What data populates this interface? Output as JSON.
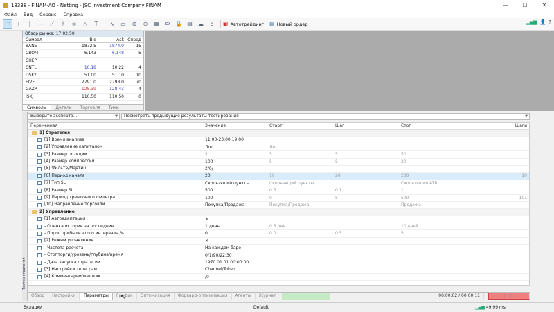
{
  "title": "18338 - FINAM-AO - Netting - JSC Investment Company FINAM",
  "menu": [
    "Файл",
    "Вид",
    "Сервис",
    "Справка"
  ],
  "window_controls": {
    "minimize": "—",
    "maximize": "☐",
    "close": "✕"
  },
  "toolbar": {
    "idx_label": "IDX",
    "autotrade_label": "Автотрейдинг",
    "new_order_label": "Новый ордер"
  },
  "market_watch": {
    "header": "Обзор рынка: 17:02:50",
    "columns": {
      "symbol": "Символ",
      "bid": "Bid",
      "ask": "Ask",
      "spread": "Спред"
    },
    "rows": [
      {
        "symbol": "BANE",
        "bid": "1872.5",
        "ask": "1874.0",
        "spread": "15"
      },
      {
        "symbol": "CBOM",
        "bid": "6.143",
        "ask": "6.148",
        "spread": "5"
      },
      {
        "symbol": "CHEP",
        "bid": "",
        "ask": "",
        "spread": ""
      },
      {
        "symbol": "CNTL",
        "bid": "10.18",
        "ask": "10.22",
        "spread": "4"
      },
      {
        "symbol": "DSKY",
        "bid": "51.00",
        "ask": "51.10",
        "spread": "10"
      },
      {
        "symbol": "FIVE",
        "bid": "2791.0",
        "ask": "2798.0",
        "spread": "70"
      },
      {
        "symbol": "GAZP",
        "bid": "128.39",
        "ask": "128.43",
        "spread": "4"
      },
      {
        "symbol": "ISKJ",
        "bid": "110.50",
        "ask": "110.50",
        "spread": "0"
      }
    ],
    "tabs": [
      "Символы",
      "Детали",
      "Торговля",
      "Тики"
    ]
  },
  "tester": {
    "side_label": "Тестер стратегий",
    "expert_placeholder": "Выберите эксперта...",
    "results_dropdown": "Посмотреть предыдущие результаты тестирования",
    "columns": {
      "name": "Переменная",
      "value": "Значение",
      "start": "Старт",
      "step": "Шаг",
      "stop": "Стоп",
      "steps": "Шаги"
    },
    "rows": [
      {
        "group": true,
        "name": "1) Стратегия"
      },
      {
        "name": "[1] Время анализа",
        "value": "11:00-23:00,19:00"
      },
      {
        "name": "[2] Управление капиталом",
        "value": "Лот",
        "start": "Лот"
      },
      {
        "name": "[3] Размер позиции",
        "value": "1",
        "start": "5",
        "step": "5",
        "stop": "50"
      },
      {
        "name": "[4] Размер компрессии",
        "value": "100",
        "start": "5",
        "step": "5",
        "stop": "20"
      },
      {
        "name": "[5] Фильтр/Мартин",
        "value": "2/0/"
      },
      {
        "name": "[6] Период канала",
        "value": "20",
        "start": "10",
        "step": "20",
        "stop": "200",
        "steps": "10",
        "selected": true
      },
      {
        "name": "[7] Тип SL",
        "value": "Скользящий пункты",
        "start": "Скользящий пункты",
        "stop": "Скользящий ATR"
      },
      {
        "name": "[8] Размер SL",
        "value": "500",
        "start": "0.5",
        "step": "0.1",
        "stop": "1"
      },
      {
        "name": "[9] Период трендового фильтра",
        "value": "100",
        "start": "0",
        "step": "5",
        "stop": "500",
        "steps": "101"
      },
      {
        "name": "[10] Направление торговли",
        "value": "Покупка/Продажа",
        "start": "Покупка/Продажа",
        "stop": "Продажа"
      },
      {
        "group": true,
        "name": "2) Управление"
      },
      {
        "name": "[1] Автоадаптация",
        "value": "✕"
      },
      {
        "name": " - Оценка истории за последние",
        "value": "1 день",
        "start": "0.5 дня",
        "stop": "10 дней"
      },
      {
        "name": " - Порог прибыли этого интервала,%",
        "value": "0",
        "start": "0.0",
        "step": "0.5",
        "stop": "5"
      },
      {
        "name": "[2] Режим управления",
        "value": "✕"
      },
      {
        "name": " - Частота расчета",
        "value": "На каждом баре"
      },
      {
        "name": " - Стопторги/уровень/глубина/время",
        "value": "0/1/90/22:30"
      },
      {
        "name": " - Дата запуска стратегии",
        "value": "1970.01.01 00:00:00"
      },
      {
        "name": "[3] Настройки телеграм",
        "value": "Channel/Token"
      },
      {
        "name": "[4] Комментарии/маджик",
        "value": "/0"
      }
    ],
    "bottom_tabs": [
      "Обзор",
      "Настройки",
      "Параметры",
      "График",
      "Оптимизация",
      "Форвард-оптимизация",
      "Агенты",
      "Журнал"
    ],
    "selected_tab": "Параметры",
    "time": "00:00:02 / 00:00:11",
    "stop_label": "Стоп"
  },
  "statusbar": {
    "left": "Вкладки",
    "middle": "Default",
    "right": "49.99 ms"
  }
}
